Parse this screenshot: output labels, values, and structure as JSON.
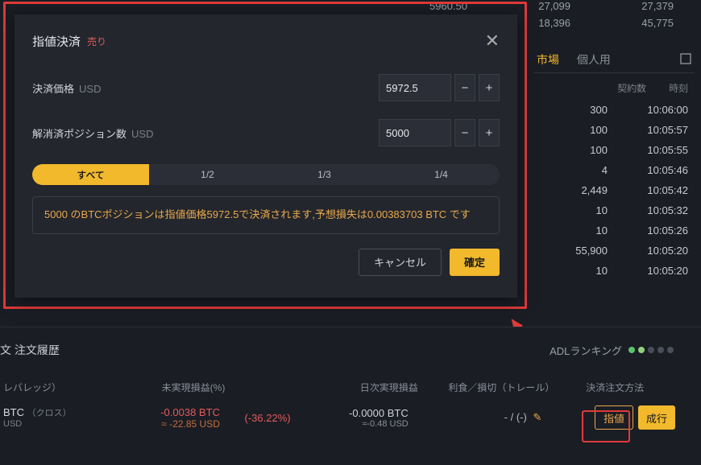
{
  "bg_top": [
    {
      "a": "5960.50",
      "b": "27,099",
      "c": "27,379"
    },
    {
      "a": "",
      "b": "18,396",
      "c": "45,775"
    }
  ],
  "modal": {
    "title": "指値決済",
    "side": "売り",
    "price_label": "決済価格",
    "price_unit": "USD",
    "price_value": "5972.5",
    "qty_label": "解消済ポジション数",
    "qty_unit": "USD",
    "qty_value": "5000",
    "segments": [
      "すべて",
      "1/2",
      "1/3",
      "1/4"
    ],
    "info": "5000 のBTCポジションは指値価格5972.5で決済されます,予想損失は0.00383703 BTC です",
    "cancel": "キャンセル",
    "confirm": "確定"
  },
  "right": {
    "tab_market": "市場",
    "tab_personal": "個人用",
    "head_qty": "契約数",
    "head_time": "時刻",
    "rows": [
      {
        "q": "300",
        "t": "10:06:00"
      },
      {
        "q": "100",
        "t": "10:05:57"
      },
      {
        "q": "100",
        "t": "10:05:55"
      },
      {
        "q": "4",
        "t": "10:05:46"
      },
      {
        "q": "2,449",
        "t": "10:05:42"
      },
      {
        "q": "10",
        "t": "10:05:32"
      },
      {
        "q": "10",
        "t": "10:05:26"
      },
      {
        "q": "55,900",
        "t": "10:05:20"
      },
      {
        "q": "10",
        "t": "10:05:20"
      }
    ]
  },
  "bottom": {
    "section_title": "文 注文履歴",
    "adl_label": "ADLランキング",
    "head": {
      "lev": "レバレッジ）",
      "pnl": "未実現損益(%)",
      "dpnl": "日次実現損益",
      "tpsl": "利食／損切（トレール）",
      "ord": "決済注文方法"
    },
    "row": {
      "sym1": "BTC",
      "sym2": "USD",
      "cross": "（クロス）",
      "pnl1": "-0.0038 BTC",
      "pnl2": "≈ -22.85 USD",
      "pct": "(-36.22%)",
      "dpnl1": "-0.0000 BTC",
      "dpnl2": "≈-0.48 USD",
      "tpsl": "- / (-)",
      "limit_btn": "指値",
      "market_btn": "成行"
    }
  }
}
